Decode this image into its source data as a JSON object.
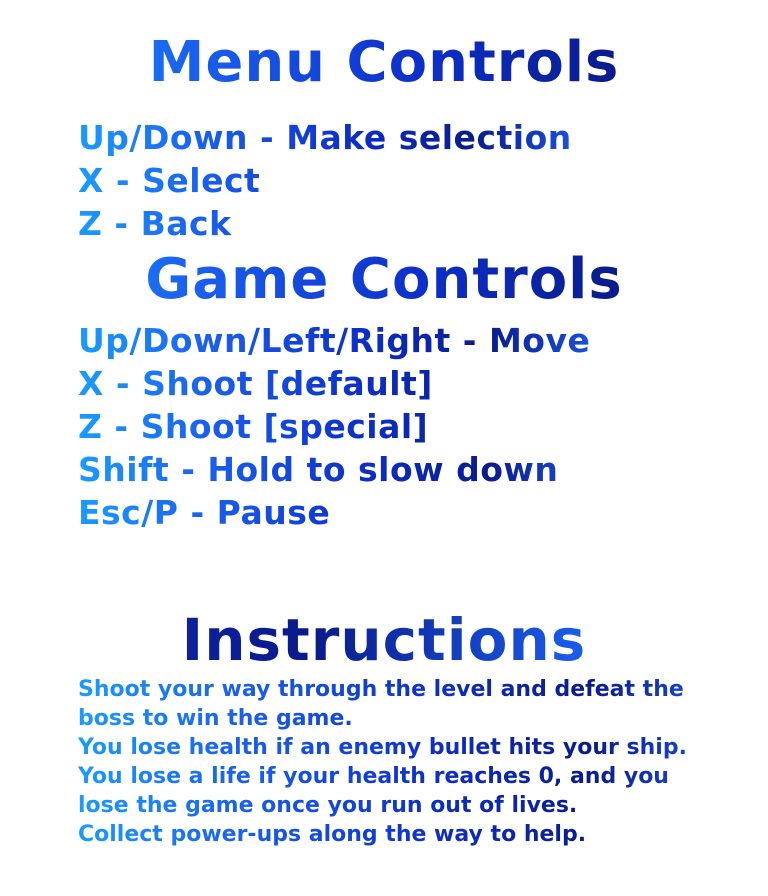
{
  "menu_controls": {
    "heading": "Menu Controls",
    "lines": [
      "Up/Down - Make selection",
      "X - Select",
      "Z - Back"
    ]
  },
  "game_controls": {
    "heading": "Game Controls",
    "lines": [
      "Up/Down/Left/Right - Move",
      "X - Shoot [default]",
      "Z - Shoot [special]",
      "Shift - Hold to slow down",
      "Esc/P - Pause"
    ]
  },
  "instructions": {
    "heading": "Instructions",
    "paragraphs": [
      "Shoot your way through the level and defeat the boss to win the game.",
      "You lose health if an enemy bullet hits your ship.",
      "You lose a life if your health reaches 0, and you lose the game once you run out of lives.",
      "Collect power-ups along the way to help."
    ]
  },
  "colors": {
    "light_blue": "#1a9cff",
    "mid_blue": "#1a5be8",
    "dark_blue": "#0a1a8a",
    "background": "#ffffff"
  }
}
